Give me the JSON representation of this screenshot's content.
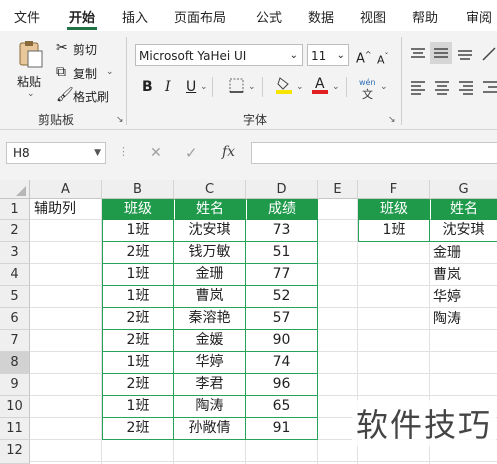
{
  "menu": {
    "items": [
      "文件",
      "开始",
      "插入",
      "页面布局",
      "公式",
      "数据",
      "视图",
      "帮助",
      "审阅"
    ],
    "active": "开始"
  },
  "ribbon": {
    "paste_label": "粘贴",
    "cut_label": "剪切",
    "copy_label": "复制",
    "format_painter_label": "格式刷",
    "clipboard_group": "剪贴板",
    "font_name": "Microsoft YaHei UI",
    "font_size": "11",
    "font_group": "字体",
    "bold": "B",
    "italic": "I",
    "underline": "U",
    "phonetic_top": "wén",
    "phonetic_bottom": "文",
    "font_color": "#e02020",
    "fill_color": "#f7e400"
  },
  "formula_bar": {
    "name_box": "H8",
    "cancel_icon": "✕",
    "enter_icon": "✓",
    "fx_label": "fx",
    "formula": ""
  },
  "columns": [
    "A",
    "B",
    "C",
    "D",
    "E",
    "F",
    "G"
  ],
  "rows": [
    "1",
    "2",
    "3",
    "4",
    "5",
    "6",
    "7",
    "8",
    "9",
    "10",
    "11",
    "12"
  ],
  "sheet": {
    "a1": "辅助列",
    "main_headers": [
      "班级",
      "姓名",
      "成绩"
    ],
    "main_rows": [
      [
        "1班",
        "沈安琪",
        "73"
      ],
      [
        "2班",
        "钱万敏",
        "51"
      ],
      [
        "1班",
        "金珊",
        "77"
      ],
      [
        "1班",
        "曹岚",
        "52"
      ],
      [
        "2班",
        "秦溶艳",
        "57"
      ],
      [
        "2班",
        "金媛",
        "90"
      ],
      [
        "1班",
        "华婷",
        "74"
      ],
      [
        "2班",
        "李君",
        "96"
      ],
      [
        "1班",
        "陶涛",
        "65"
      ],
      [
        "2班",
        "孙敞倩",
        "91"
      ]
    ],
    "lookup_headers": [
      "班级",
      "姓名"
    ],
    "lookup_class": "1班",
    "lookup_names": [
      "沈安琪",
      "金珊",
      "曹岚",
      "华婷",
      "陶涛"
    ]
  },
  "watermark": "软件技巧",
  "colors": {
    "header_green": "#1f9a4b",
    "excel_green": "#217346"
  }
}
